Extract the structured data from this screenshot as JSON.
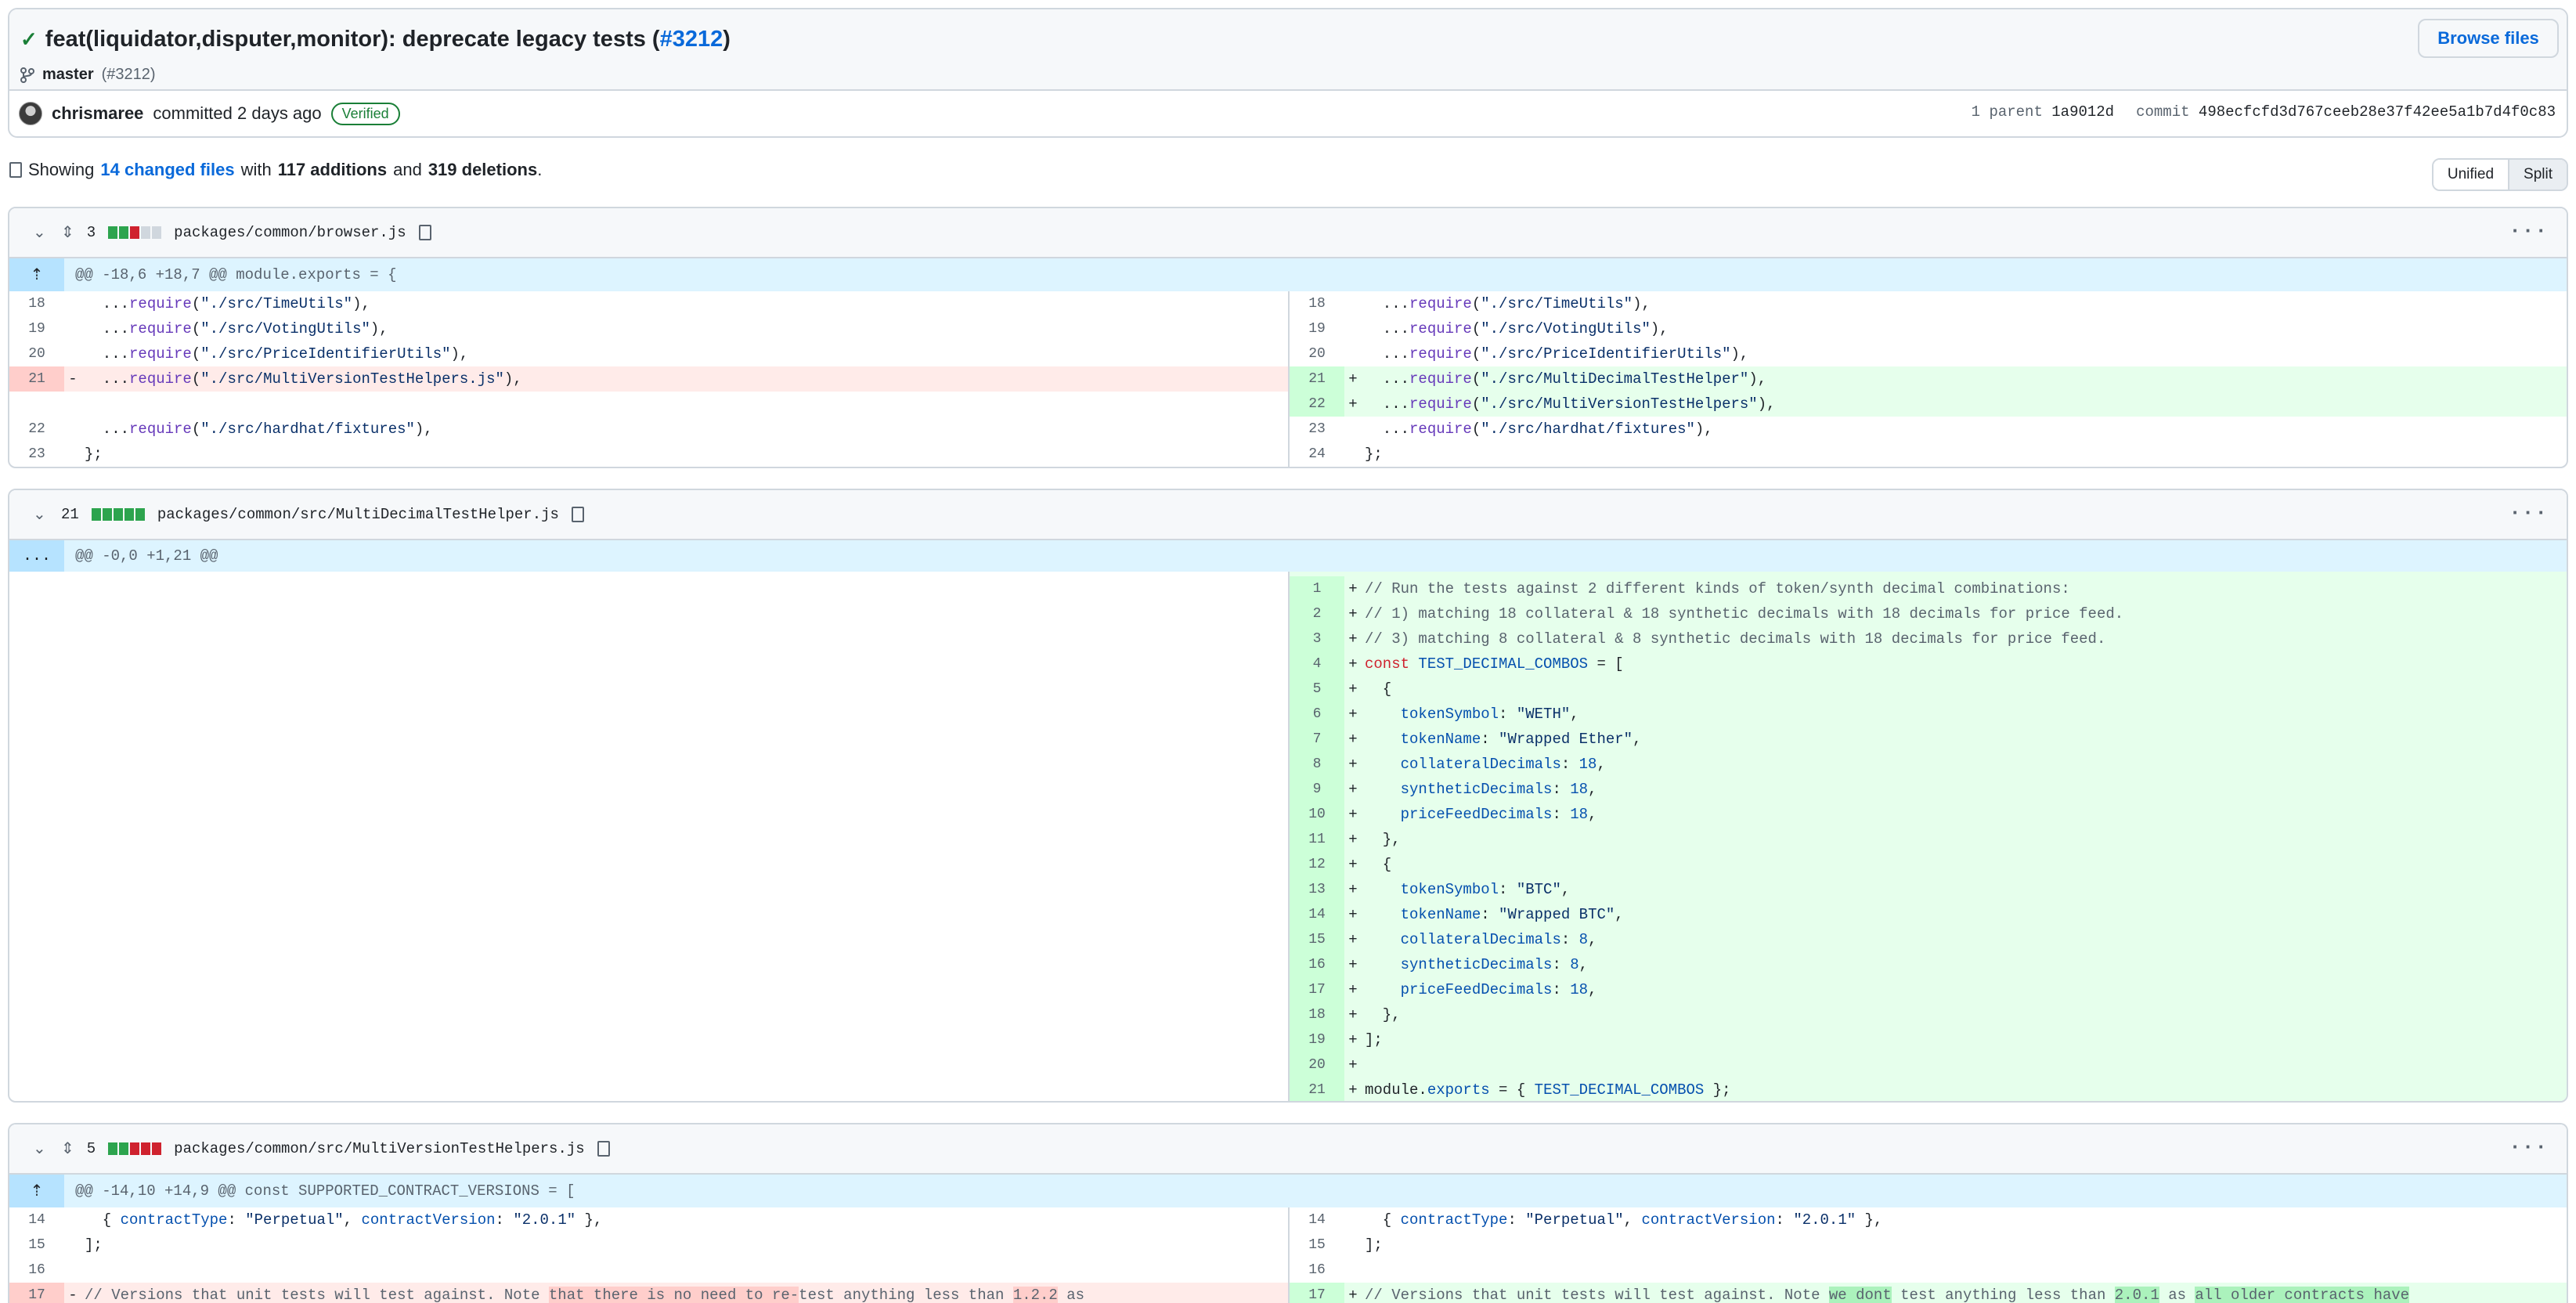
{
  "commit": {
    "title": "feat(liquidator,disputer,monitor): deprecate legacy tests (",
    "pr_link": "#3212",
    "title_end": ")",
    "branch": "master",
    "branch_pr": "(#3212)",
    "browse_label": "Browse files",
    "author": "chrismaree",
    "committed_text": "committed 2 days ago",
    "verified": "Verified",
    "parent_label": "1 parent",
    "parent_sha": "1a9012d",
    "commit_label": "commit",
    "commit_sha": "498ecfcfd3d767ceeb28e37f42ee5a1b7d4f0c83"
  },
  "summary": {
    "showing": "Showing",
    "changed_files": "14 changed files",
    "with": "with",
    "additions": "117 additions",
    "and": "and",
    "deletions": "319 deletions",
    "period": ".",
    "unified_label": "Unified",
    "split_label": "Split"
  },
  "files": [
    {
      "count": "3",
      "name": "packages/common/browser.js",
      "hunk": "@@ -18,6 +18,7 @@ module.exports = {"
    },
    {
      "count": "21",
      "name": "packages/common/src/MultiDecimalTestHelper.js",
      "hunk": "@@ -0,0 +1,21 @@",
      "hunk_expand": "..."
    },
    {
      "count": "5",
      "name": "packages/common/src/MultiVersionTestHelpers.js",
      "hunk": "@@ -14,10 +14,9 @@ const SUPPORTED_CONTRACT_VERSIONS = ["
    }
  ],
  "file1": {
    "left": [
      {
        "n": "18",
        "pre": "  ...",
        "fn": "require",
        "a": "(",
        "s": "\"./src/TimeUtils\"",
        "b": "),"
      },
      {
        "n": "19",
        "pre": "  ...",
        "fn": "require",
        "a": "(",
        "s": "\"./src/VotingUtils\"",
        "b": "),"
      },
      {
        "n": "20",
        "pre": "  ...",
        "fn": "require",
        "a": "(",
        "s": "\"./src/PriceIdentifierUtils\"",
        "b": "),"
      },
      {
        "n": "21",
        "pre": "  ...",
        "fn": "require",
        "a": "(",
        "s": "\"./src/MultiVersionTestHelpers.js\"",
        "b": "),"
      },
      {
        "n": "22",
        "pre": "  ...",
        "fn": "require",
        "a": "(",
        "s": "\"./src/hardhat/fixtures\"",
        "b": "),"
      },
      {
        "n": "23",
        "text": "};"
      }
    ],
    "right": [
      {
        "n": "18",
        "pre": "  ...",
        "fn": "require",
        "a": "(",
        "s": "\"./src/TimeUtils\"",
        "b": "),"
      },
      {
        "n": "19",
        "pre": "  ...",
        "fn": "require",
        "a": "(",
        "s": "\"./src/VotingUtils\"",
        "b": "),"
      },
      {
        "n": "20",
        "pre": "  ...",
        "fn": "require",
        "a": "(",
        "s": "\"./src/PriceIdentifierUtils\"",
        "b": "),"
      },
      {
        "n": "21",
        "pre": "  ...",
        "fn": "require",
        "a": "(",
        "s": "\"./src/MultiDecimalTestHelper\"",
        "b": "),"
      },
      {
        "n": "22",
        "pre": "  ...",
        "fn": "require",
        "a": "(",
        "s": "\"./src/MultiVersionTestHelpers\"",
        "b": "),"
      },
      {
        "n": "23",
        "pre": "  ...",
        "fn": "require",
        "a": "(",
        "s": "\"./src/hardhat/fixtures\"",
        "b": "),"
      },
      {
        "n": "24",
        "text": "};"
      }
    ],
    "minus": "-",
    "plus": "+"
  },
  "file2": {
    "lines": [
      {
        "n": "1",
        "cm": "// Run the tests against 2 different kinds of token/synth decimal combinations:"
      },
      {
        "n": "2",
        "cm": "// 1) matching 18 collateral & 18 synthetic decimals with 18 decimals for price feed."
      },
      {
        "n": "3",
        "cm": "// 3) matching 8 collateral & 8 synthetic decimals with 18 decimals for price feed."
      },
      {
        "n": "4",
        "kw": "const",
        "cst": " TEST_DECIMAL_COMBOS",
        "rest": " = ["
      },
      {
        "n": "5",
        "rest": "  {"
      },
      {
        "n": "6",
        "pre": "    ",
        "cst": "tokenSymbol",
        "rest": ": ",
        "s": "\"WETH\"",
        "end": ","
      },
      {
        "n": "7",
        "pre": "    ",
        "cst": "tokenName",
        "rest": ": ",
        "s": "\"Wrapped Ether\"",
        "end": ","
      },
      {
        "n": "8",
        "pre": "    ",
        "cst": "collateralDecimals",
        "rest": ": ",
        "num": "18",
        "end": ","
      },
      {
        "n": "9",
        "pre": "    ",
        "cst": "syntheticDecimals",
        "rest": ": ",
        "num": "18",
        "end": ","
      },
      {
        "n": "10",
        "pre": "    ",
        "cst": "priceFeedDecimals",
        "rest": ": ",
        "num": "18",
        "end": ","
      },
      {
        "n": "11",
        "rest": "  },"
      },
      {
        "n": "12",
        "rest": "  {"
      },
      {
        "n": "13",
        "pre": "    ",
        "cst": "tokenSymbol",
        "rest": ": ",
        "s": "\"BTC\"",
        "end": ","
      },
      {
        "n": "14",
        "pre": "    ",
        "cst": "tokenName",
        "rest": ": ",
        "s": "\"Wrapped BTC\"",
        "end": ","
      },
      {
        "n": "15",
        "pre": "    ",
        "cst": "collateralDecimals",
        "rest": ": ",
        "num": "8",
        "end": ","
      },
      {
        "n": "16",
        "pre": "    ",
        "cst": "syntheticDecimals",
        "rest": ": ",
        "num": "8",
        "end": ","
      },
      {
        "n": "17",
        "pre": "    ",
        "cst": "priceFeedDecimals",
        "rest": ": ",
        "num": "18",
        "end": ","
      },
      {
        "n": "18",
        "rest": "  },"
      },
      {
        "n": "19",
        "rest": "];"
      },
      {
        "n": "20",
        "rest": ""
      },
      {
        "n": "21",
        "pre": "module.",
        "cst": "exports",
        "rest": " = { ",
        "s2": "TEST_DECIMAL_COMBOS",
        "end": " };"
      }
    ]
  },
  "file3": {
    "left": [
      {
        "n": "14",
        "pre": "  { ",
        "k1": "contractType",
        "m1": ": ",
        "s1": "\"Perpetual\"",
        "m2": ", ",
        "k2": "contractVersion",
        "m3": ": ",
        "s2": "\"2.0.1\"",
        "end": " },"
      },
      {
        "n": "15",
        "text": "];"
      },
      {
        "n": "16",
        "text": ""
      }
    ],
    "right": [
      {
        "n": "14",
        "pre": "  { ",
        "k1": "contractType",
        "m1": ": ",
        "s1": "\"Perpetual\"",
        "m2": ", ",
        "k2": "contractVersion",
        "m3": ": ",
        "s2": "\"2.0.1\"",
        "end": " },"
      },
      {
        "n": "15",
        "text": "];"
      },
      {
        "n": "16",
        "text": ""
      }
    ],
    "del17": {
      "n": "17",
      "a": "// Versions that unit tests will test against. Note ",
      "h1": "that there is no need to re-",
      "b": "test anything less than ",
      "h2": "1.2.2",
      "c": " as"
    },
    "add17": {
      "n": "17",
      "a": "// Versions that unit tests will test against. Note ",
      "h1": "we dont",
      "b": " test anything less than ",
      "h2": "2.0.1",
      "c": " as ",
      "h3": "all older contracts have"
    }
  }
}
